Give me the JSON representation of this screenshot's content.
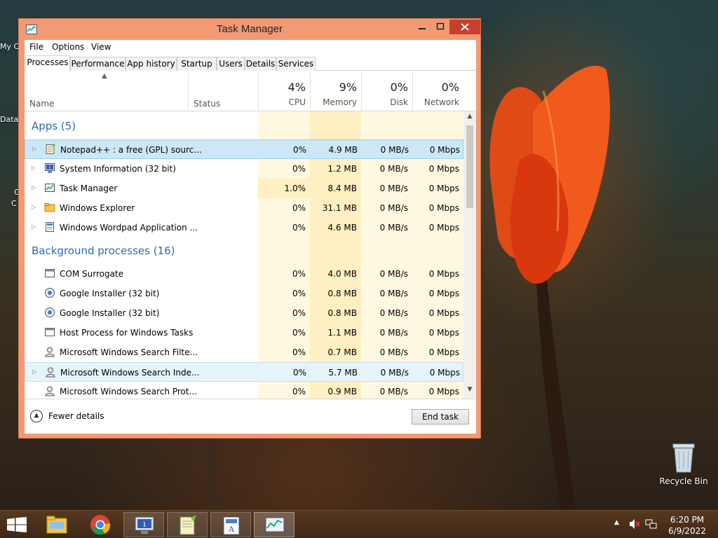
{
  "window": {
    "title": "Task Manager"
  },
  "menu": [
    "File",
    "Options",
    "View"
  ],
  "tabs": [
    "Processes",
    "Performance",
    "App history",
    "Startup",
    "Users",
    "Details",
    "Services"
  ],
  "active_tab": "Processes",
  "columns": {
    "name": "Name",
    "status": "Status",
    "cpu": {
      "pct": "4%",
      "label": "CPU"
    },
    "memory": {
      "pct": "9%",
      "label": "Memory"
    },
    "disk": {
      "pct": "0%",
      "label": "Disk"
    },
    "network": {
      "pct": "0%",
      "label": "Network"
    }
  },
  "groups": {
    "apps": "Apps (5)",
    "background": "Background processes (16)"
  },
  "apps": [
    {
      "name": "Notepad++ : a free (GPL) sourc...",
      "cpu": "0%",
      "memory": "4.9 MB",
      "disk": "0 MB/s",
      "network": "0 Mbps",
      "icon": "notepadpp-icon"
    },
    {
      "name": "System Information (32 bit)",
      "cpu": "0%",
      "memory": "1.2 MB",
      "disk": "0 MB/s",
      "network": "0 Mbps",
      "icon": "system-information-icon"
    },
    {
      "name": "Task Manager",
      "cpu": "1.0%",
      "memory": "8.4 MB",
      "disk": "0 MB/s",
      "network": "0 Mbps",
      "icon": "task-manager-icon"
    },
    {
      "name": "Windows Explorer",
      "cpu": "0%",
      "memory": "31.1 MB",
      "disk": "0 MB/s",
      "network": "0 Mbps",
      "icon": "folder-icon"
    },
    {
      "name": "Windows Wordpad Application ...",
      "cpu": "0%",
      "memory": "4.6 MB",
      "disk": "0 MB/s",
      "network": "0 Mbps",
      "icon": "wordpad-icon"
    }
  ],
  "background": [
    {
      "name": "COM Surrogate",
      "cpu": "0%",
      "memory": "4.0 MB",
      "disk": "0 MB/s",
      "network": "0 Mbps",
      "icon": "window-process-icon"
    },
    {
      "name": "Google Installer (32 bit)",
      "cpu": "0%",
      "memory": "0.8 MB",
      "disk": "0 MB/s",
      "network": "0 Mbps",
      "icon": "installer-icon"
    },
    {
      "name": "Google Installer (32 bit)",
      "cpu": "0%",
      "memory": "0.8 MB",
      "disk": "0 MB/s",
      "network": "0 Mbps",
      "icon": "installer-icon"
    },
    {
      "name": "Host Process for Windows Tasks",
      "cpu": "0%",
      "memory": "1.1 MB",
      "disk": "0 MB/s",
      "network": "0 Mbps",
      "icon": "window-process-icon"
    },
    {
      "name": "Microsoft Windows Search Filte...",
      "cpu": "0%",
      "memory": "0.7 MB",
      "disk": "0 MB/s",
      "network": "0 Mbps",
      "icon": "search-user-icon"
    },
    {
      "name": "Microsoft Windows Search Inde...",
      "cpu": "0%",
      "memory": "5.7 MB",
      "disk": "0 MB/s",
      "network": "0 Mbps",
      "icon": "search-user-icon"
    },
    {
      "name": "Microsoft Windows Search Prot...",
      "cpu": "0%",
      "memory": "0.9 MB",
      "disk": "0 MB/s",
      "network": "0 Mbps",
      "icon": "search-user-icon"
    }
  ],
  "footer": {
    "fewer_details": "Fewer details",
    "end_task": "End task"
  },
  "desktop": {
    "partial_icons": [
      "My C",
      "Data",
      "G",
      "C"
    ],
    "recycle_bin": "Recycle Bin"
  },
  "taskbar": {
    "apps": [
      "file-explorer-icon",
      "chrome-icon",
      "system-information-icon",
      "notepadpp-icon",
      "wordpad-icon",
      "task-manager-icon"
    ],
    "time": "6:20 PM",
    "date": "6/9/2022"
  },
  "colors": {
    "window_frame": "#f39a74",
    "close_button": "#c7402e",
    "group_title": "#2a6cb5",
    "selected_row": "#cce8f6",
    "heat_light": "#fff8e1",
    "heat_medium": "#fff0c3"
  }
}
